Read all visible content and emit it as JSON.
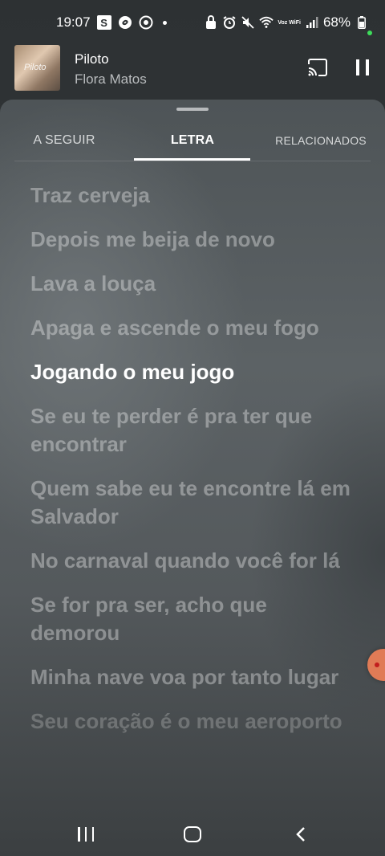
{
  "status_bar": {
    "time": "19:07",
    "battery": "68%",
    "wifi_label": "Voz WiFi",
    "icons": [
      "s-app-icon",
      "shazam-icon",
      "chrome-icon",
      "notification-dot",
      "vpn-icon",
      "alarm-icon",
      "mute-icon",
      "wifi-icon",
      "signal-icon",
      "battery-icon"
    ]
  },
  "mini_player": {
    "title": "Piloto",
    "artist": "Flora Matos",
    "thumb_text": "Piloto",
    "cast_icon": "cast-icon",
    "pause_icon": "pause-icon"
  },
  "tabs": [
    {
      "label": "A SEGUIR",
      "active": false
    },
    {
      "label": "LETRA",
      "active": true
    },
    {
      "label": "RELACIONADOS",
      "active": false
    }
  ],
  "lyrics": [
    "Traz cerveja",
    "Depois me beija de novo",
    "Lava a louça",
    "Apaga e ascende o meu fogo",
    "Jogando o meu jogo",
    "Se eu te perder é pra ter que encontrar",
    "Quem sabe eu te encontre lá em Salvador",
    "No carnaval quando você for lá",
    "Se for pra ser, acho que demorou",
    "Minha nave voa por tanto lugar",
    "Seu coração é o meu aeroporto"
  ],
  "current_line_index": 4,
  "nav_bar": {
    "icons": [
      "recent-apps-icon",
      "home-icon",
      "back-icon"
    ]
  },
  "colors": {
    "accent_float": "#e07b56",
    "active_text": "#ffffff"
  }
}
